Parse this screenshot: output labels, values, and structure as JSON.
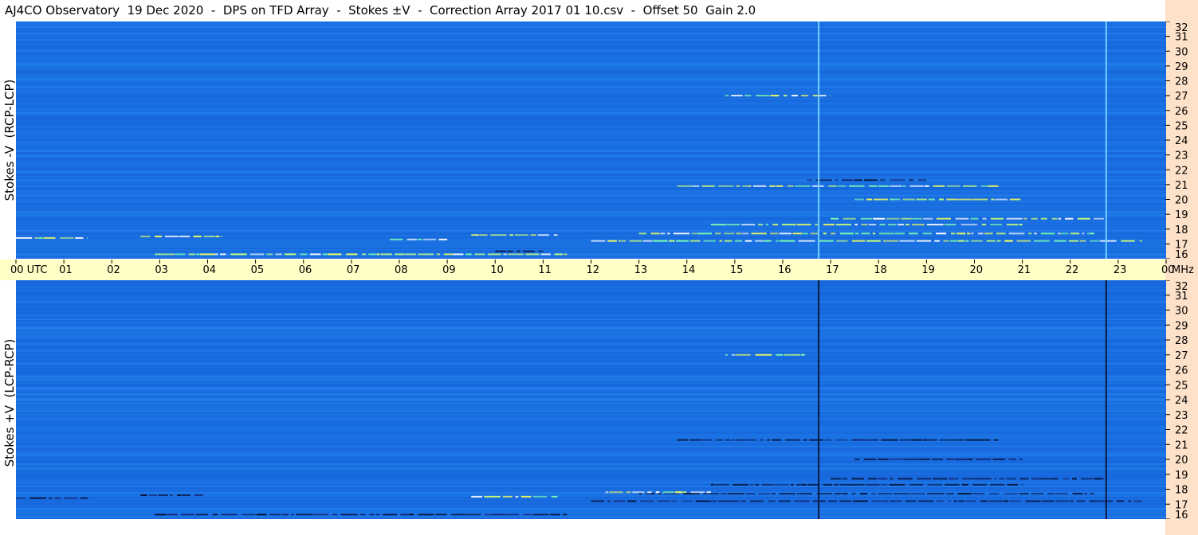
{
  "title": "AJ4CO Observatory  19 Dec 2020  -  DPS on TFD Array  -  Stokes ±V  -  Correction Array 2017 01 10.csv  -  Offset 50  Gain 2.0",
  "colors": {
    "background": "#1a6fe0",
    "time_strip": "#ffffc6",
    "freq_strip": "#fde1c8",
    "emission_bright": "#f4ff60",
    "emission_dark": "#0a1a50"
  },
  "chart_data": [
    {
      "type": "heatmap",
      "panel": "top",
      "ylabel": "Stokes -V  (RCP-LCP)",
      "x": [
        "00 UTC",
        "01",
        "02",
        "03",
        "04",
        "05",
        "06",
        "07",
        "08",
        "09",
        "10",
        "11",
        "12",
        "13",
        "14",
        "15",
        "16",
        "17",
        "18",
        "19",
        "20",
        "21",
        "22",
        "23",
        "00"
      ],
      "x_unit": "UTC",
      "y": [
        16,
        17,
        18,
        19,
        20,
        21,
        22,
        23,
        24,
        25,
        26,
        27,
        28,
        29,
        30,
        31,
        32
      ],
      "y_unit": "MHz",
      "xlim": [
        0,
        24
      ],
      "ylim": [
        16,
        32
      ],
      "vertical_lines_utc": [
        16.75,
        22.75
      ],
      "vertical_line_color": "#6fd0ff",
      "emission_bands": [
        {
          "mhz": 17.2,
          "start": 12.0,
          "end": 23.5,
          "tone": "bright"
        },
        {
          "mhz": 17.7,
          "start": 13.0,
          "end": 22.5,
          "tone": "bright"
        },
        {
          "mhz": 18.3,
          "start": 14.5,
          "end": 21.0,
          "tone": "bright"
        },
        {
          "mhz": 18.7,
          "start": 17.0,
          "end": 22.7,
          "tone": "bright"
        },
        {
          "mhz": 20.0,
          "start": 17.5,
          "end": 21.0,
          "tone": "bright"
        },
        {
          "mhz": 20.9,
          "start": 13.8,
          "end": 20.5,
          "tone": "bright"
        },
        {
          "mhz": 16.3,
          "start": 2.9,
          "end": 11.5,
          "tone": "bright"
        },
        {
          "mhz": 17.5,
          "start": 2.6,
          "end": 4.3,
          "tone": "bright"
        },
        {
          "mhz": 17.6,
          "start": 9.5,
          "end": 11.3,
          "tone": "bright"
        },
        {
          "mhz": 17.3,
          "start": 7.8,
          "end": 9.0,
          "tone": "bright"
        },
        {
          "mhz": 27.0,
          "start": 14.8,
          "end": 17.0,
          "tone": "bright"
        },
        {
          "mhz": 17.4,
          "start": 0.0,
          "end": 1.5,
          "tone": "bright"
        },
        {
          "mhz": 16.5,
          "start": 10.0,
          "end": 11.0,
          "tone": "dark"
        },
        {
          "mhz": 21.3,
          "start": 16.5,
          "end": 19.0,
          "tone": "dark"
        }
      ]
    },
    {
      "type": "heatmap",
      "panel": "bottom",
      "ylabel": "Stokes +V  (LCP-RCP)",
      "x_unit": "UTC",
      "y": [
        16,
        17,
        18,
        19,
        20,
        21,
        22,
        23,
        24,
        25,
        26,
        27,
        28,
        29,
        30,
        31,
        32
      ],
      "y_unit": "MHz",
      "xlim": [
        0,
        24
      ],
      "ylim": [
        16,
        32
      ],
      "vertical_lines_utc": [
        16.75,
        22.75
      ],
      "vertical_line_color": "#0a1a40",
      "emission_bands": [
        {
          "mhz": 17.2,
          "start": 12.0,
          "end": 23.5,
          "tone": "dark"
        },
        {
          "mhz": 17.7,
          "start": 13.0,
          "end": 22.5,
          "tone": "dark"
        },
        {
          "mhz": 18.3,
          "start": 14.5,
          "end": 21.0,
          "tone": "dark"
        },
        {
          "mhz": 18.7,
          "start": 17.0,
          "end": 22.7,
          "tone": "dark"
        },
        {
          "mhz": 20.0,
          "start": 17.5,
          "end": 21.0,
          "tone": "dark"
        },
        {
          "mhz": 21.3,
          "start": 13.8,
          "end": 20.5,
          "tone": "dark"
        },
        {
          "mhz": 16.3,
          "start": 2.9,
          "end": 11.5,
          "tone": "dark"
        },
        {
          "mhz": 17.6,
          "start": 2.6,
          "end": 3.9,
          "tone": "dark"
        },
        {
          "mhz": 17.8,
          "start": 12.3,
          "end": 14.5,
          "tone": "bright"
        },
        {
          "mhz": 17.5,
          "start": 9.5,
          "end": 11.3,
          "tone": "bright"
        },
        {
          "mhz": 27.0,
          "start": 14.8,
          "end": 16.5,
          "tone": "bright"
        },
        {
          "mhz": 17.4,
          "start": 0.0,
          "end": 1.5,
          "tone": "dark"
        }
      ]
    }
  ],
  "freq_axis_label": "MHz"
}
